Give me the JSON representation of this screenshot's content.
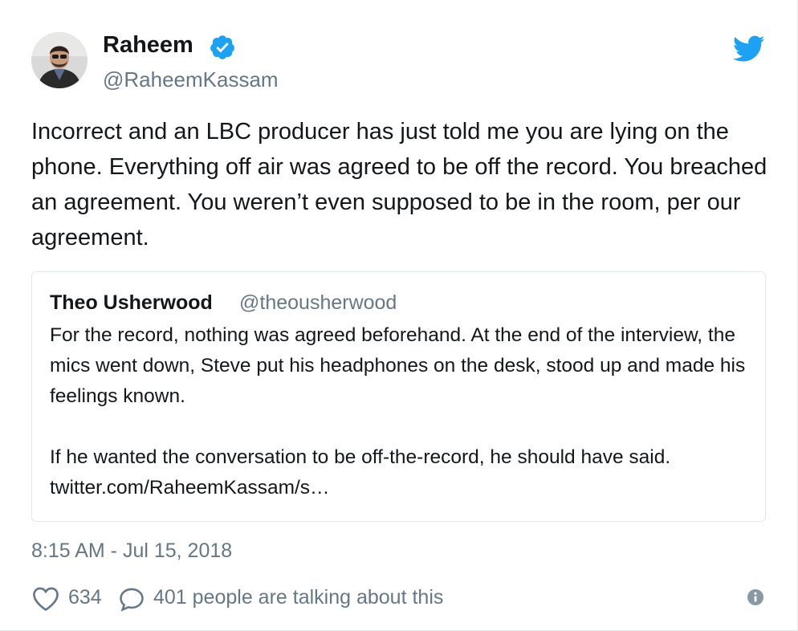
{
  "author": {
    "name": "Raheem",
    "handle": "@RaheemKassam",
    "verified": true,
    "avatar_icon": "user-avatar"
  },
  "brand_icon": "twitter-bird-icon",
  "brand_color": "#1da1f2",
  "tweet_text": "Incorrect and an LBC producer has just told me you are lying on the phone. Everything off air was agreed to be off the record. You breached an agreement. You weren’t even supposed to be in the room, per our agreement.",
  "quoted_tweet": {
    "name": "Theo Usherwood",
    "handle": "@theousherwood",
    "paragraphs": [
      "For the record, nothing was agreed beforehand. At the end of the interview, the mics went down, Steve put his headphones on the desk, stood up and made his feelings known.",
      "If he wanted the conversation to be off-the-record, he should have said. twitter.com/RaheemKassam/s…"
    ]
  },
  "timestamp": "8:15 AM - Jul 15, 2018",
  "stats": {
    "likes": "634",
    "talking": "401 people are talking about this"
  },
  "icons": {
    "like": "heart-icon",
    "reply": "speech-bubble-icon",
    "info": "info-icon",
    "verified": "verified-badge-icon"
  }
}
